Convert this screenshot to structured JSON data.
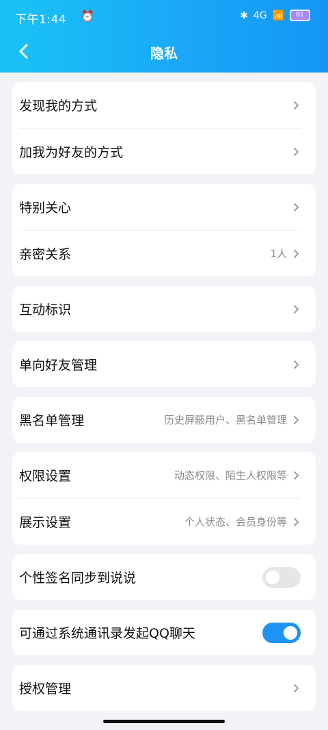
{
  "status": {
    "time": "下午1:44",
    "battery": "81",
    "signal": "4G"
  },
  "nav": {
    "title": "隐私"
  },
  "sections": [
    {
      "items": [
        {
          "label": "发现我的方式",
          "meta": ""
        },
        {
          "label": "加我为好友的方式",
          "meta": ""
        }
      ]
    },
    {
      "items": [
        {
          "label": "特别关心",
          "meta": ""
        },
        {
          "label": "亲密关系",
          "meta": "1人"
        }
      ]
    },
    {
      "items": [
        {
          "label": "互动标识",
          "meta": ""
        }
      ]
    },
    {
      "items": [
        {
          "label": "单向好友管理",
          "meta": ""
        }
      ]
    },
    {
      "items": [
        {
          "label": "黑名单管理",
          "meta": "历史屏蔽用户、黑名单管理"
        }
      ]
    },
    {
      "items": [
        {
          "label": "权限设置",
          "meta": "动态权限、陌生人权限等"
        },
        {
          "label": "展示设置",
          "meta": "个人状态、会员身份等"
        }
      ]
    },
    {
      "items": [
        {
          "label": "个性签名同步到说说",
          "toggle": false
        }
      ]
    },
    {
      "items": [
        {
          "label": "可通过系统通讯录发起QQ聊天",
          "toggle": true
        }
      ]
    },
    {
      "items": [
        {
          "label": "授权管理",
          "meta": ""
        }
      ]
    }
  ],
  "colors": {
    "header_from": "#19c3f5",
    "header_to": "#1596f4",
    "toggle_on": "#1e93f5",
    "toggle_off": "#e6e6e6"
  },
  "icons": {
    "back": "chevron-left-icon",
    "chevron": "chevron-right-icon",
    "alarm": "alarm-icon",
    "bluetooth": "bluetooth-icon",
    "wifi": "wifi-icon",
    "battery": "battery-icon"
  }
}
